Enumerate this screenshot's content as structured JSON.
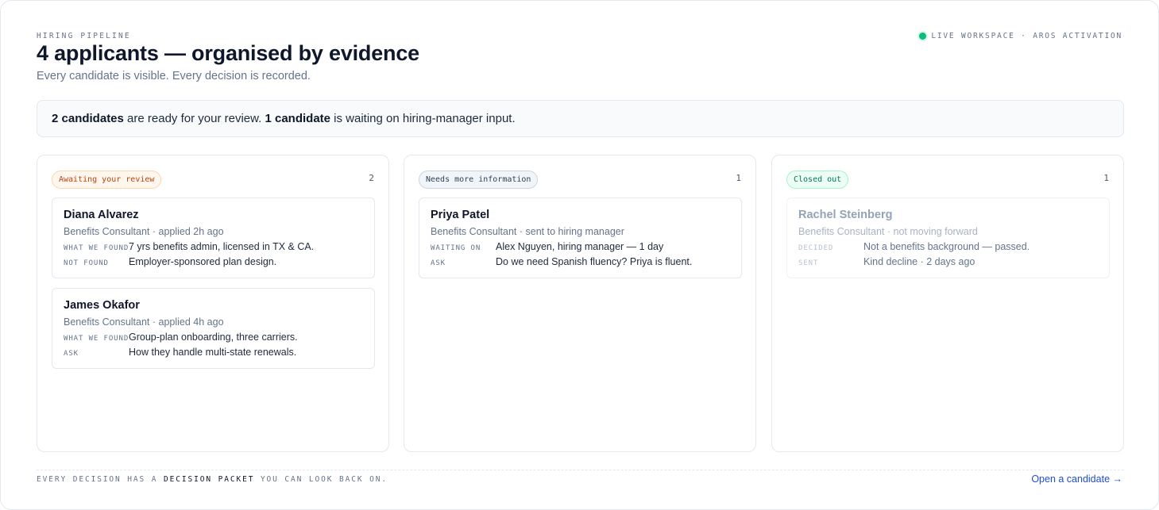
{
  "header": {
    "eyebrow": "HIRING PIPELINE",
    "title": "4 applicants — organised by evidence",
    "subtitle": "Every candidate is visible. Every decision is recorded.",
    "status": "LIVE WORKSPACE · AROS ACTIVATION",
    "status_color": "#10b981"
  },
  "summary": {
    "part1_bold": "2 candidates",
    "part2": "are ready for your review.",
    "part3_bold": "1 candidate",
    "part4": "is waiting on hiring-manager input."
  },
  "columns": [
    {
      "badge": "Awaiting your review",
      "count": "2",
      "cards": [
        {
          "name": "Diana Alvarez",
          "meta": "Benefits Consultant · applied 2h ago",
          "fields": [
            {
              "label": "WHAT WE FOUND",
              "value": "7 yrs benefits admin, licensed in TX & CA."
            },
            {
              "label": "NOT FOUND",
              "value": "Employer-sponsored plan design."
            }
          ]
        },
        {
          "name": "James Okafor",
          "meta": "Benefits Consultant · applied 4h ago",
          "fields": [
            {
              "label": "WHAT WE FOUND",
              "value": "Group-plan onboarding, three carriers."
            },
            {
              "label": "ASK",
              "value": "How they handle multi-state renewals."
            }
          ]
        }
      ]
    },
    {
      "badge": "Needs more information",
      "count": "1",
      "cards": [
        {
          "name": "Priya Patel",
          "meta": "Benefits Consultant · sent to hiring manager",
          "fields": [
            {
              "label": "WAITING ON",
              "value": "Alex Nguyen, hiring manager — 1 day"
            },
            {
              "label": "ASK",
              "value": "Do we need Spanish fluency? Priya is fluent."
            }
          ]
        }
      ]
    },
    {
      "badge": "Closed out",
      "count": "1",
      "cards": [
        {
          "name": "Rachel Steinberg",
          "meta": "Benefits Consultant · not moving forward",
          "fields": [
            {
              "label": "DECIDED",
              "value": "Not a benefits background — passed."
            },
            {
              "label": "SENT",
              "value": "Kind decline · 2 days ago"
            }
          ]
        }
      ]
    }
  ],
  "footer": {
    "note_prefix": "EVERY DECISION HAS A",
    "note_em": "DECISION PACKET",
    "note_suffix": "YOU CAN LOOK BACK ON.",
    "link": "Open a candidate →"
  }
}
